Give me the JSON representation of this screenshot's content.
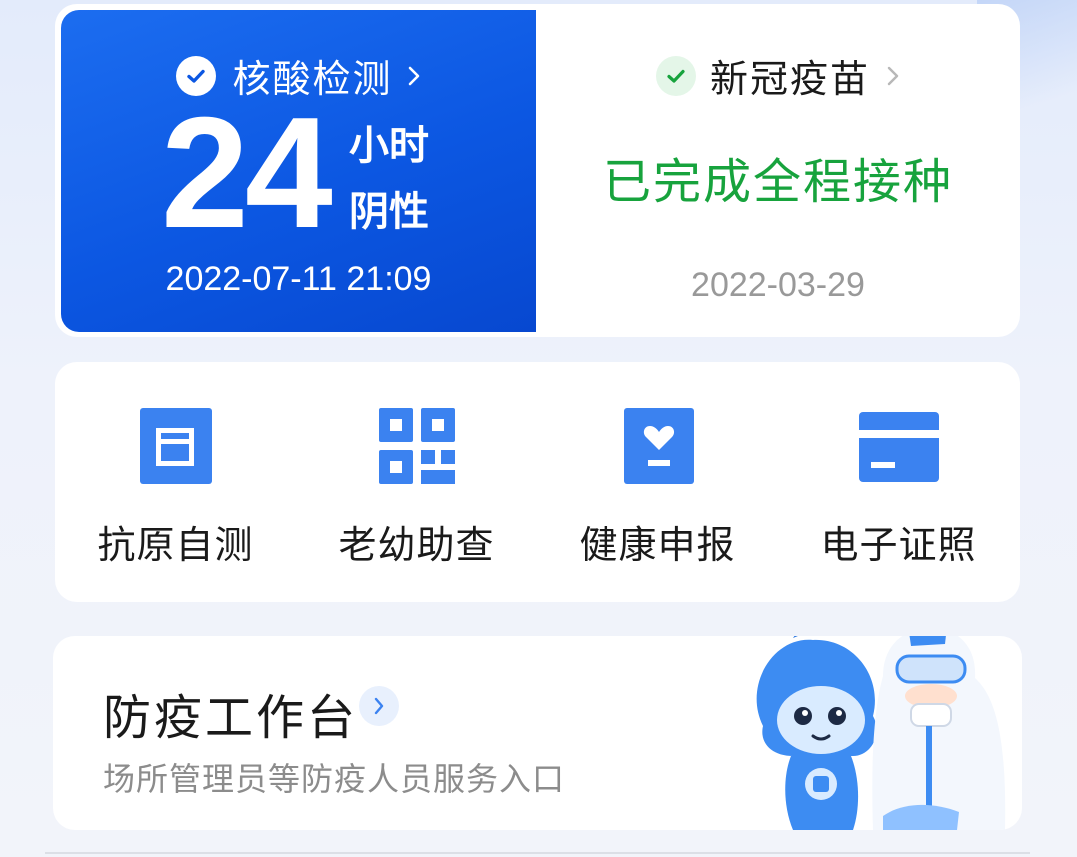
{
  "nucleic_test": {
    "title": "核酸检测",
    "hours": "24",
    "hours_unit": "小时",
    "result": "阴性",
    "time": "2022-07-11 21:09"
  },
  "vaccine": {
    "title": "新冠疫苗",
    "status": "已完成全程接种",
    "date": "2022-03-29"
  },
  "services": [
    {
      "label": "抗原自测",
      "icon": "antigen-test-icon"
    },
    {
      "label": "老幼助查",
      "icon": "qr-code-icon"
    },
    {
      "label": "健康申报",
      "icon": "heart-report-icon"
    },
    {
      "label": "电子证照",
      "icon": "card-icon"
    }
  ],
  "workbench": {
    "title": "防疫工作台",
    "subtitle": "场所管理员等防疫人员服务入口"
  },
  "colors": {
    "primary_blue": "#0c57e2",
    "icon_blue": "#3b82f0",
    "success_green": "#17a33d",
    "muted_gray": "#999999"
  }
}
